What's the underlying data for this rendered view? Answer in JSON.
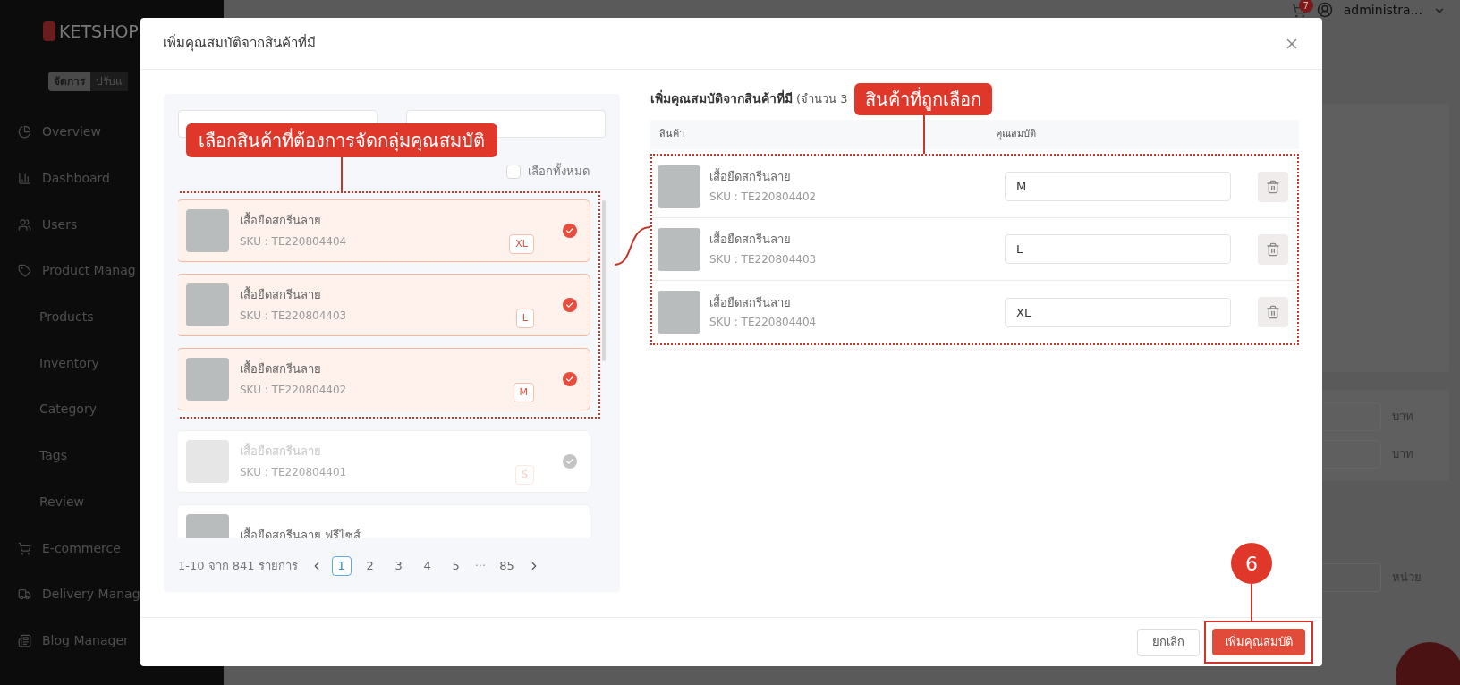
{
  "sidebar": {
    "logo": "KETSHOP",
    "mode_toggle": [
      {
        "label": "จัดการ",
        "selected": true
      },
      {
        "label": "ปรับแ",
        "selected": false
      }
    ],
    "items": [
      {
        "label": "Overview",
        "kind": "main"
      },
      {
        "label": "Dashboard",
        "kind": "main"
      },
      {
        "label": "Users",
        "kind": "main"
      },
      {
        "label": "Product Manag",
        "kind": "main"
      },
      {
        "label": "Products",
        "kind": "sub"
      },
      {
        "label": "Inventory",
        "kind": "sub"
      },
      {
        "label": "Category",
        "kind": "sub"
      },
      {
        "label": "Tags",
        "kind": "sub"
      },
      {
        "label": "Review",
        "kind": "sub"
      },
      {
        "label": "E-commerce",
        "kind": "main"
      },
      {
        "label": "Delivery Manag",
        "kind": "main"
      },
      {
        "label": "Blog Manager",
        "kind": "main"
      }
    ]
  },
  "top_bar": {
    "cart_badge": "7",
    "user": "administra..."
  },
  "background_form": {
    "units": [
      "บาท",
      "บาท",
      "หน่วย"
    ]
  },
  "modal": {
    "title": "เพิ่มคุณสมบัติจากสินค้าที่มี",
    "left_panel": {
      "select_all": {
        "label": "เลือกทั้งหมด",
        "checked": false
      },
      "items": [
        {
          "name": "เสื้อยืดสกรีนลาย",
          "sku": "SKU : TE220804404",
          "size": "XL",
          "selected": true,
          "disabled": false
        },
        {
          "name": "เสื้อยืดสกรีนลาย",
          "sku": "SKU : TE220804403",
          "size": "L",
          "selected": true,
          "disabled": false
        },
        {
          "name": "เสื้อยืดสกรีนลาย",
          "sku": "SKU : TE220804402",
          "size": "M",
          "selected": true,
          "disabled": false
        },
        {
          "name": "เสื้อยืดสกรีนลาย",
          "sku": "SKU : TE220804401",
          "size": "S",
          "selected": false,
          "disabled": true
        },
        {
          "name": "เสื้อยืดสกรีนลาย ฟรีไซส์",
          "selected": false,
          "disabled": false
        }
      ],
      "pagination": {
        "summary": "1-10 จาก 841 รายการ",
        "pages": [
          {
            "label": "1",
            "kind": "page",
            "selected": true
          },
          {
            "label": "2",
            "kind": "page",
            "selected": false
          },
          {
            "label": "3",
            "kind": "page",
            "selected": false
          },
          {
            "label": "4",
            "kind": "page",
            "selected": false
          },
          {
            "label": "5",
            "kind": "page",
            "selected": false
          },
          {
            "label": "···",
            "kind": "ellipsis"
          },
          {
            "label": "85",
            "kind": "page",
            "selected": false
          }
        ]
      }
    },
    "right_panel": {
      "heading": "เพิ่มคุณสมบัติจากสินค้าที่มี",
      "count": "(จำนวน 3",
      "columns": [
        "สินค้า",
        "คุณสมบัติ"
      ],
      "rows": [
        {
          "name": "เสื้อยืดสกรีนลาย",
          "sku": "SKU : TE220804402",
          "value": "M"
        },
        {
          "name": "เสื้อยืดสกรีนลาย",
          "sku": "SKU : TE220804403",
          "value": "L"
        },
        {
          "name": "เสื้อยืดสกรีนลาย",
          "sku": "SKU : TE220804404",
          "value": "XL"
        }
      ]
    },
    "buttons": {
      "cancel": "ยกเลิก",
      "confirm": "เพิ่มคุณสมบัติ"
    }
  },
  "annotations": {
    "left_callout": "เลือกสินค้าที่ต้องการจัดกลุ่มคุณสมบัติ",
    "right_callout": "สินค้าที่ถูกเลือก",
    "step": "6"
  }
}
